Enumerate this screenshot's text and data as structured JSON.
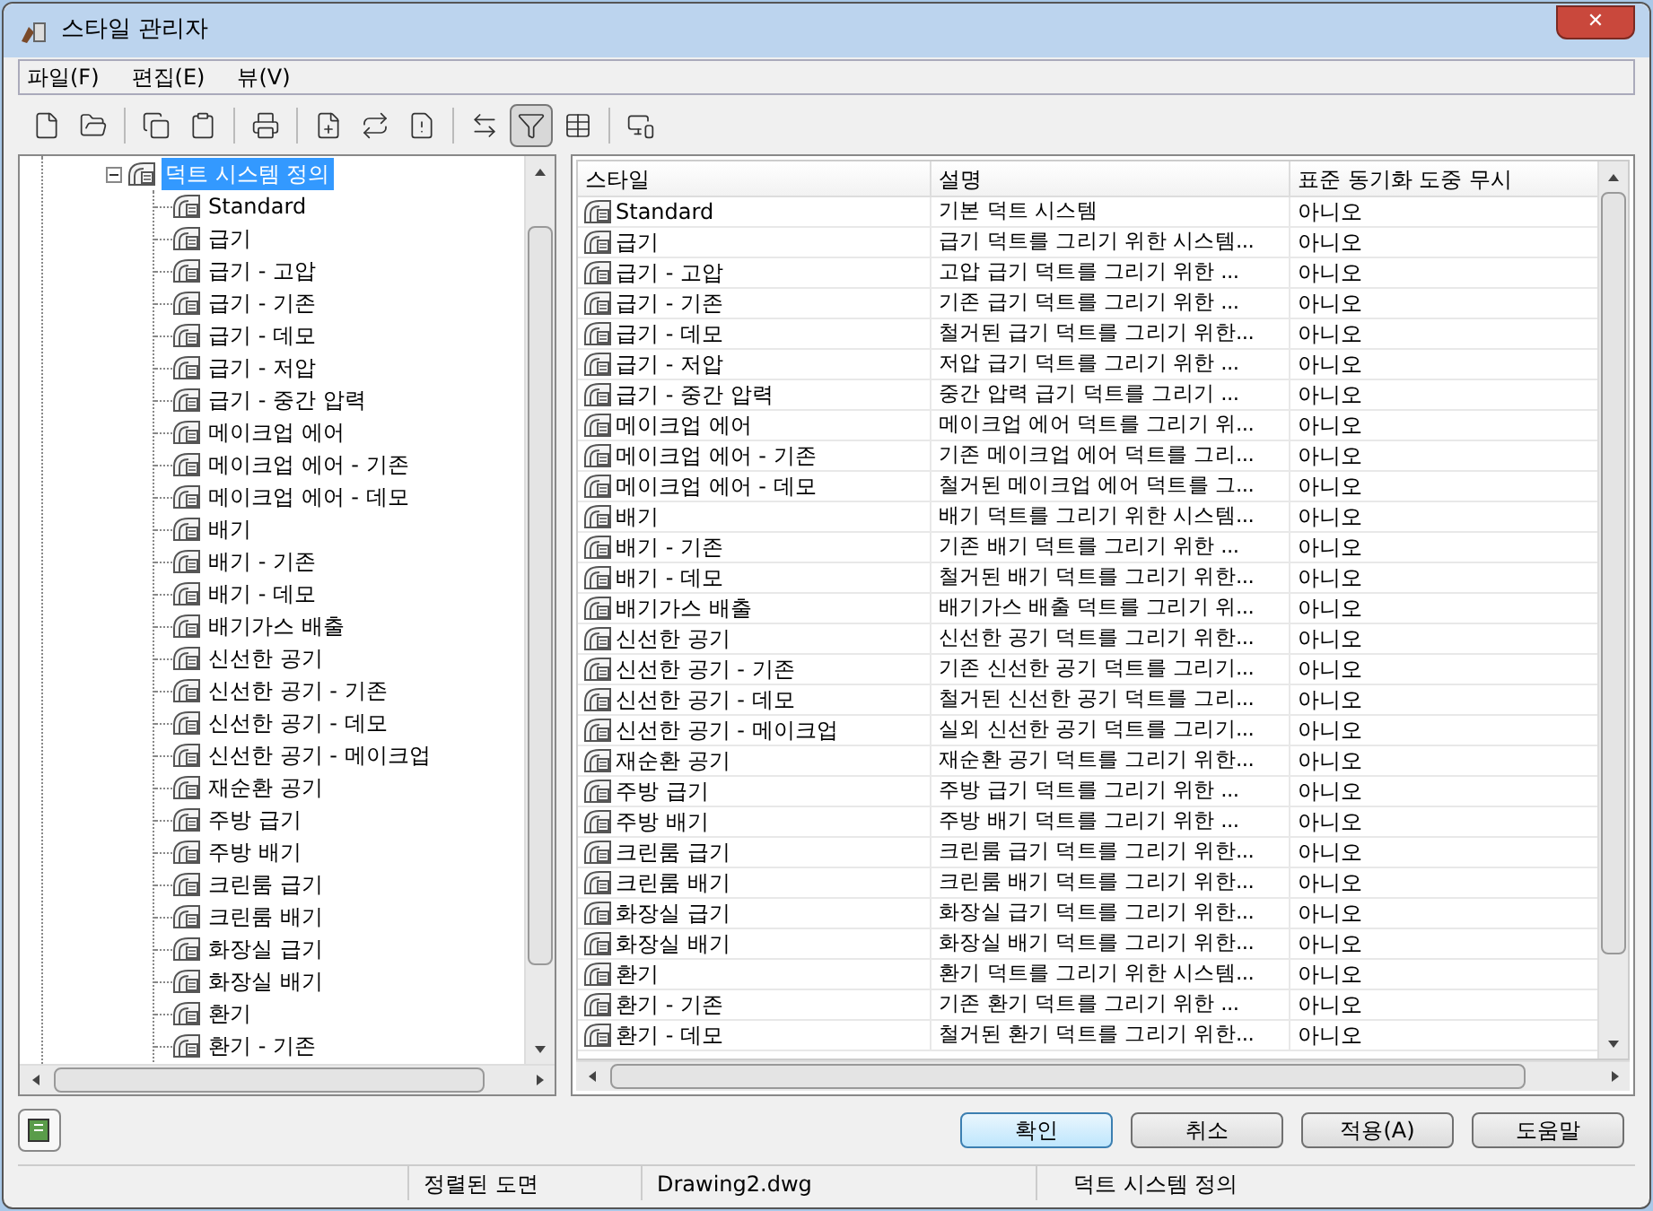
{
  "window": {
    "title": "스타일 관리자",
    "close": "✕"
  },
  "menu": [
    {
      "label": "파일(F)"
    },
    {
      "label": "편집(E)"
    },
    {
      "label": "뷰(V)"
    }
  ],
  "toolbar": [
    {
      "pressed": false
    },
    {
      "pressed": false
    },
    {
      "pressed": false
    },
    {
      "pressed": false
    },
    {
      "pressed": false
    },
    {
      "pressed": false
    },
    {
      "pressed": false
    },
    {
      "pressed": false
    },
    {
      "pressed": false
    },
    {
      "pressed": true
    },
    {
      "pressed": false
    },
    {
      "pressed": false
    }
  ],
  "tree": {
    "label": "덕트 시스템 정의",
    "selected": true,
    "expanded": true,
    "children": [
      {
        "label": "Standard",
        "selected": false
      },
      {
        "label": "급기",
        "selected": false
      },
      {
        "label": "급기 - 고압",
        "selected": false
      },
      {
        "label": "급기 - 기존",
        "selected": false
      },
      {
        "label": "급기 - 데모",
        "selected": false
      },
      {
        "label": "급기 - 저압",
        "selected": false
      },
      {
        "label": "급기 - 중간 압력",
        "selected": false
      },
      {
        "label": "메이크업 에어",
        "selected": false
      },
      {
        "label": "메이크업 에어 - 기존",
        "selected": false
      },
      {
        "label": "메이크업 에어 - 데모",
        "selected": false
      },
      {
        "label": "배기",
        "selected": false
      },
      {
        "label": "배기 - 기존",
        "selected": false
      },
      {
        "label": "배기 - 데모",
        "selected": false
      },
      {
        "label": "배기가스 배출",
        "selected": false
      },
      {
        "label": "신선한 공기",
        "selected": false
      },
      {
        "label": "신선한 공기 - 기존",
        "selected": false
      },
      {
        "label": "신선한 공기 - 데모",
        "selected": false
      },
      {
        "label": "신선한 공기 - 메이크업",
        "selected": false
      },
      {
        "label": "재순환 공기",
        "selected": false
      },
      {
        "label": "주방 급기",
        "selected": false
      },
      {
        "label": "주방 배기",
        "selected": false
      },
      {
        "label": "크린룸 급기",
        "selected": false
      },
      {
        "label": "크린룸 배기",
        "selected": false
      },
      {
        "label": "화장실 급기",
        "selected": false
      },
      {
        "label": "화장실 배기",
        "selected": false
      },
      {
        "label": "환기",
        "selected": false
      },
      {
        "label": "환기 - 기존",
        "selected": false
      }
    ]
  },
  "table": {
    "columns": [
      "스타일",
      "설명",
      "표준 동기화 도중 무시"
    ],
    "rows": [
      [
        "Standard",
        "기본 덕트 시스템",
        "아니오"
      ],
      [
        "급기",
        "급기 덕트를 그리기 위한 시스템...",
        "아니오"
      ],
      [
        "급기 - 고압",
        "고압 급기 덕트를 그리기 위한 ...",
        "아니오"
      ],
      [
        "급기 - 기존",
        "기존 급기 덕트를 그리기 위한 ...",
        "아니오"
      ],
      [
        "급기 - 데모",
        "철거된 급기 덕트를 그리기 위한...",
        "아니오"
      ],
      [
        "급기 - 저압",
        "저압 급기 덕트를 그리기 위한 ...",
        "아니오"
      ],
      [
        "급기 - 중간 압력",
        "중간 압력 급기 덕트를 그리기 ...",
        "아니오"
      ],
      [
        "메이크업 에어",
        "메이크업 에어 덕트를 그리기 위...",
        "아니오"
      ],
      [
        "메이크업 에어 - 기존",
        "기존 메이크업 에어 덕트를 그리...",
        "아니오"
      ],
      [
        "메이크업 에어 - 데모",
        "철거된 메이크업 에어 덕트를 그...",
        "아니오"
      ],
      [
        "배기",
        "배기 덕트를 그리기 위한 시스템...",
        "아니오"
      ],
      [
        "배기 - 기존",
        "기존 배기 덕트를 그리기 위한 ...",
        "아니오"
      ],
      [
        "배기 - 데모",
        "철거된 배기 덕트를 그리기 위한...",
        "아니오"
      ],
      [
        "배기가스 배출",
        "배기가스 배출 덕트를 그리기 위...",
        "아니오"
      ],
      [
        "신선한 공기",
        "신선한 공기 덕트를 그리기 위한...",
        "아니오"
      ],
      [
        "신선한 공기 - 기존",
        "기존 신선한 공기 덕트를 그리기...",
        "아니오"
      ],
      [
        "신선한 공기 - 데모",
        "철거된 신선한 공기 덕트를 그리...",
        "아니오"
      ],
      [
        "신선한 공기 - 메이크업",
        "실외 신선한 공기 덕트를 그리기...",
        "아니오"
      ],
      [
        "재순환 공기",
        "재순환 공기 덕트를 그리기 위한...",
        "아니오"
      ],
      [
        "주방 급기",
        "주방 급기 덕트를 그리기 위한 ...",
        "아니오"
      ],
      [
        "주방 배기",
        "주방 배기 덕트를 그리기 위한 ...",
        "아니오"
      ],
      [
        "크린룸 급기",
        "크린룸 급기 덕트를 그리기 위한...",
        "아니오"
      ],
      [
        "크린룸 배기",
        "크린룸 배기 덕트를 그리기 위한...",
        "아니오"
      ],
      [
        "화장실 급기",
        "화장실 급기 덕트를 그리기 위한...",
        "아니오"
      ],
      [
        "화장실 배기",
        "화장실 배기 덕트를 그리기 위한...",
        "아니오"
      ],
      [
        "환기",
        "환기 덕트를 그리기 위한 시스템...",
        "아니오"
      ],
      [
        "환기 - 기존",
        "기존 환기 덕트를 그리기 위한 ...",
        "아니오"
      ],
      [
        "환기 - 데모",
        "철거된 환기 덕트를 그리기 위한...",
        "아니오"
      ]
    ]
  },
  "buttons": [
    {
      "label": "확인",
      "default": true
    },
    {
      "label": "취소",
      "default": false
    },
    {
      "label": "적용(A)",
      "default": false
    },
    {
      "label": "도움말",
      "default": false
    }
  ],
  "status_bar": [
    "정렬된 도면",
    "Drawing2.dwg",
    "덕트 시스템 정의"
  ]
}
